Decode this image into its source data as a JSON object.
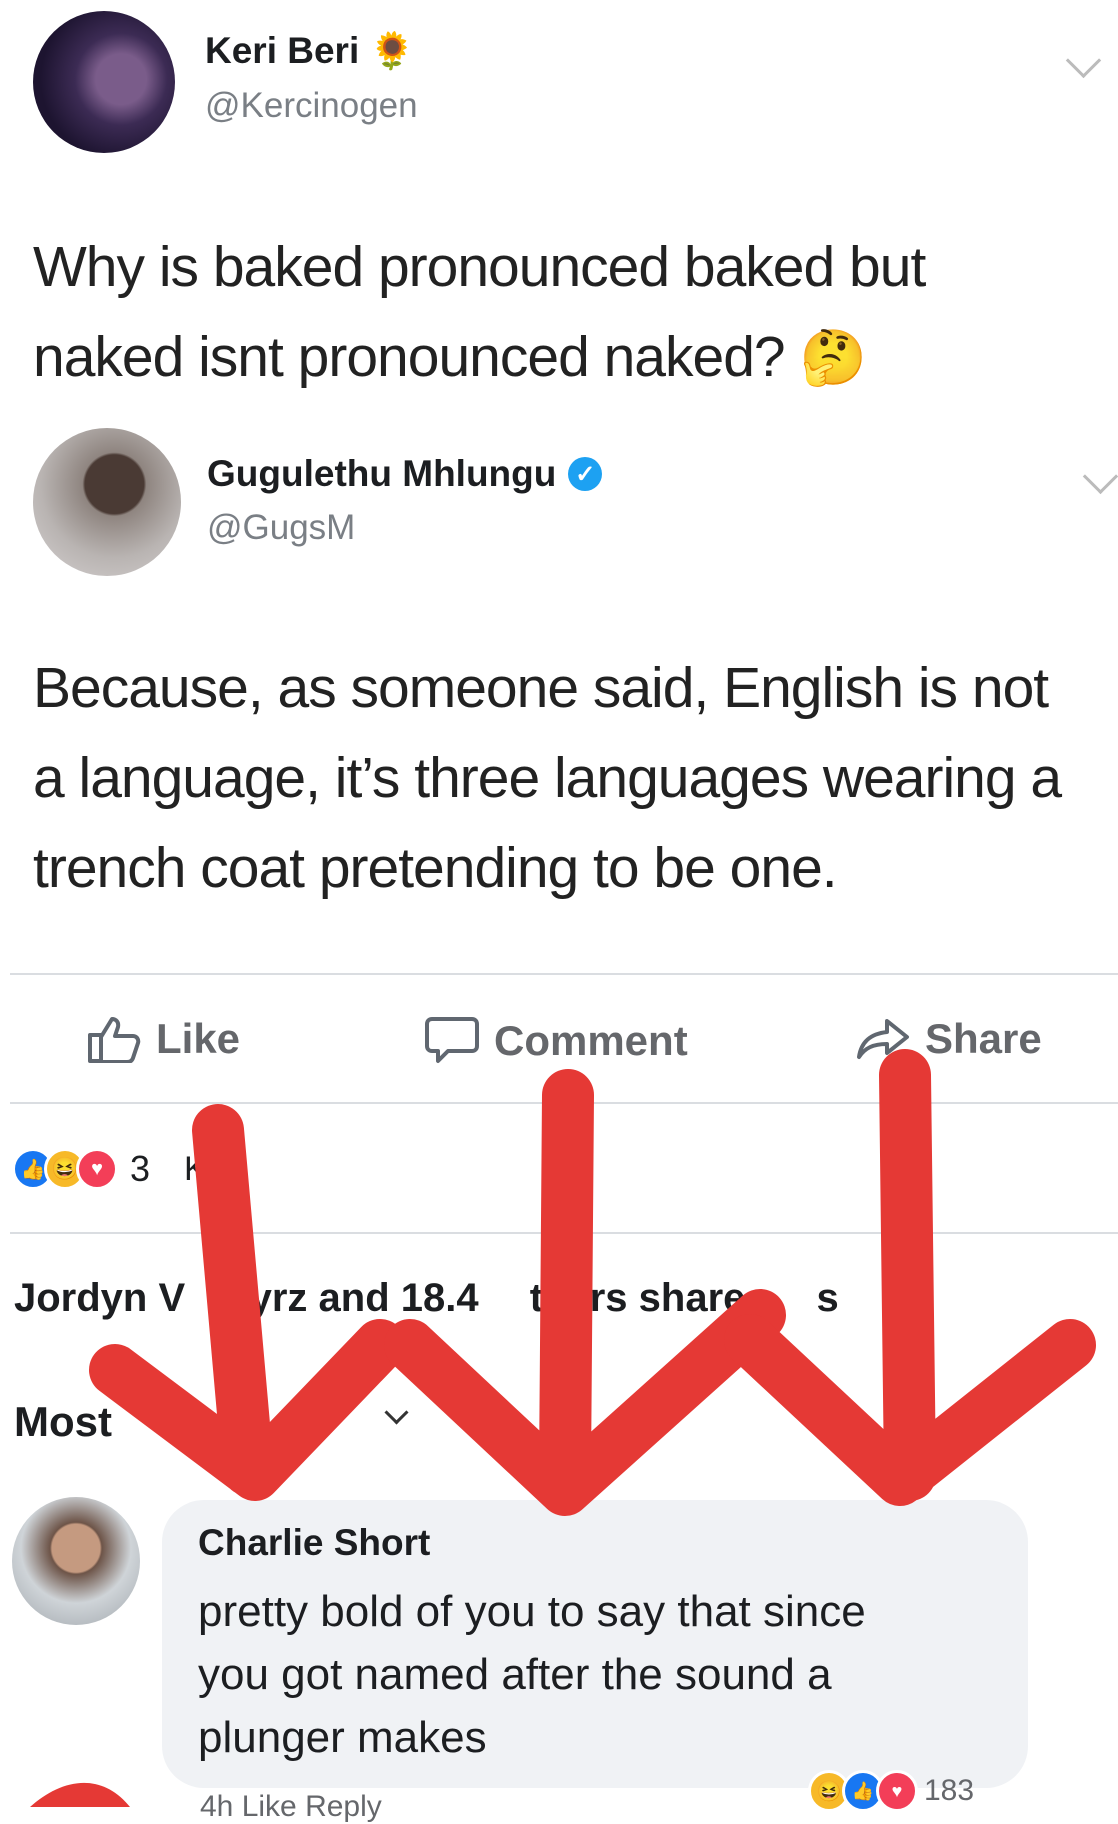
{
  "tweet1": {
    "name": "Keri Beri",
    "name_emoji": "🌻",
    "handle": "@Kercinogen",
    "text_line1": "Why is baked pronounced baked but",
    "text_line2": "naked isnt pronounced naked?",
    "emoji": "🤔"
  },
  "tweet2": {
    "name": "Gugulethu Mhlungu",
    "handle": "@GugsM",
    "verified": true,
    "text_line1": "Because, as someone said, English is not",
    "text_line2": "a language, it’s three languages wearing a",
    "text_line3": "trench coat pretending to be one."
  },
  "actions": {
    "like": "Like",
    "comment": "Comment",
    "share": "Share"
  },
  "reactions": {
    "count_fragment": "K",
    "count_partial": "3"
  },
  "shares": {
    "part1": "Jordyn V",
    "part2": "tyrz and 18.4",
    "part3": "thers share",
    "part4": "s"
  },
  "sort": {
    "label": "Most"
  },
  "comment": {
    "author": "Charlie Short",
    "line1": "pretty bold of you to say that since",
    "line2": "you got named after the sound a",
    "line3": "plunger makes",
    "reaction_count": "183",
    "footer_partial": "4h   Like   Reply"
  },
  "colors": {
    "facebook_blue": "#1877f2",
    "annotation_red": "#e53935",
    "love_red": "#f33e58",
    "haha_yellow": "#f7b928"
  }
}
